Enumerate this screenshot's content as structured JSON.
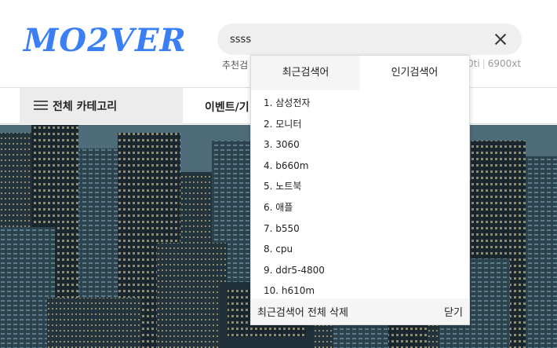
{
  "logo": {
    "text": "MO2VER"
  },
  "search": {
    "value": "ssss"
  },
  "recommend": {
    "label": "추천검",
    "tail_1": "0ti",
    "tail_2": "6900xt"
  },
  "nav": {
    "all_categories": "전체 카테고리",
    "event": "이벤트/기"
  },
  "dropdown": {
    "tab_recent": "최근검색어",
    "tab_popular": "인기검색어",
    "items": [
      "1. 삼성전자",
      "2. 모니터",
      "3. 3060",
      "4. b660m",
      "5. 노트북",
      "6. 애플",
      "7. b550",
      "8. cpu",
      "9. ddr5-4800",
      "10. h610m"
    ],
    "delete_all": "최근검색어 전체 삭제",
    "close": "닫기"
  },
  "colors": {
    "brand": "#3b7ff5"
  }
}
